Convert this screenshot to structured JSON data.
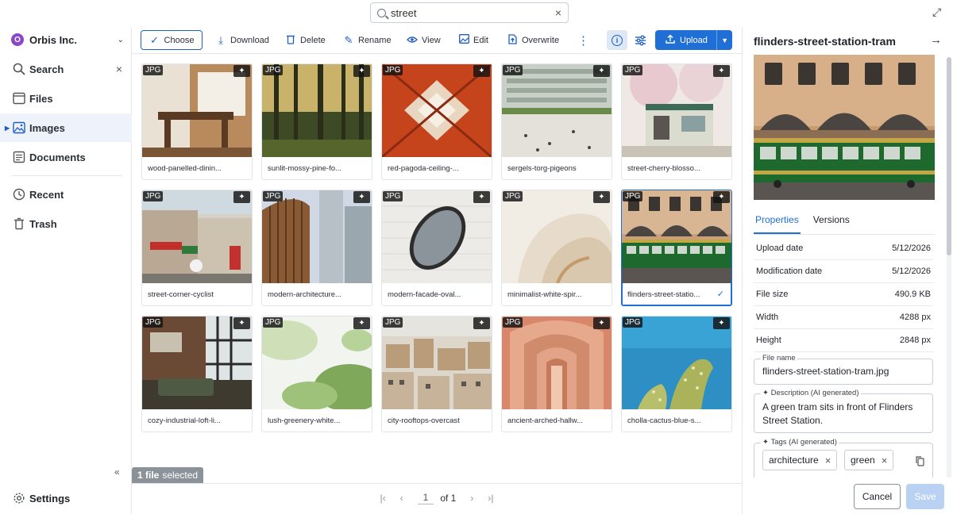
{
  "search": {
    "value": "street",
    "placeholder": ""
  },
  "org": {
    "badge": "O",
    "name": "Orbis Inc."
  },
  "nav": {
    "search": "Search",
    "files": "Files",
    "images": "Images",
    "documents": "Documents",
    "recent": "Recent",
    "trash": "Trash",
    "settings": "Settings"
  },
  "toolbar": {
    "choose": "Choose",
    "download": "Download",
    "delete": "Delete",
    "rename": "Rename",
    "view": "View",
    "edit": "Edit",
    "overwrite": "Overwrite",
    "upload": "Upload"
  },
  "file_type_label": "JPG",
  "cards": [
    {
      "name": "wood-panelled-dinin...",
      "selected": false
    },
    {
      "name": "sunlit-mossy-pine-fo...",
      "selected": false
    },
    {
      "name": "red-pagoda-ceiling-...",
      "selected": false
    },
    {
      "name": "sergels-torg-pigeons",
      "selected": false
    },
    {
      "name": "street-cherry-blosso...",
      "selected": false
    },
    {
      "name": "street-corner-cyclist",
      "selected": false
    },
    {
      "name": "modern-architecture...",
      "selected": false
    },
    {
      "name": "modern-facade-oval...",
      "selected": false
    },
    {
      "name": "minimalist-white-spir...",
      "selected": false
    },
    {
      "name": "flinders-street-statio...",
      "selected": true
    },
    {
      "name": "cozy-industrial-loft-li...",
      "selected": false
    },
    {
      "name": "lush-greenery-white...",
      "selected": false
    },
    {
      "name": "city-rooftops-overcast",
      "selected": false
    },
    {
      "name": "ancient-arched-hallw...",
      "selected": false
    },
    {
      "name": "cholla-cactus-blue-s...",
      "selected": false
    }
  ],
  "selection": {
    "count": "1 file",
    "suffix": "selected"
  },
  "pager": {
    "page": "1",
    "of": "of 1"
  },
  "details": {
    "title": "flinders-street-station-tram",
    "tabs": {
      "properties": "Properties",
      "versions": "Versions"
    },
    "props": [
      {
        "label": "Upload date",
        "value": "5/12/2026"
      },
      {
        "label": "Modification date",
        "value": "5/12/2026"
      },
      {
        "label": "File size",
        "value": "490.9 KB"
      },
      {
        "label": "Width",
        "value": "4288 px"
      },
      {
        "label": "Height",
        "value": "2848 px"
      }
    ],
    "file_name_label": "File name",
    "file_name": "flinders-street-station-tram.jpg",
    "description_label": "Description (AI generated)",
    "description": "A green tram sits in front of Flinders Street Station.",
    "tags_label": "Tags (AI generated)",
    "tags": [
      "architecture",
      "green"
    ],
    "cancel": "Cancel",
    "save": "Save"
  },
  "colors": {
    "accent": "#1f6fd6",
    "org_badge": "#8b47c6"
  }
}
